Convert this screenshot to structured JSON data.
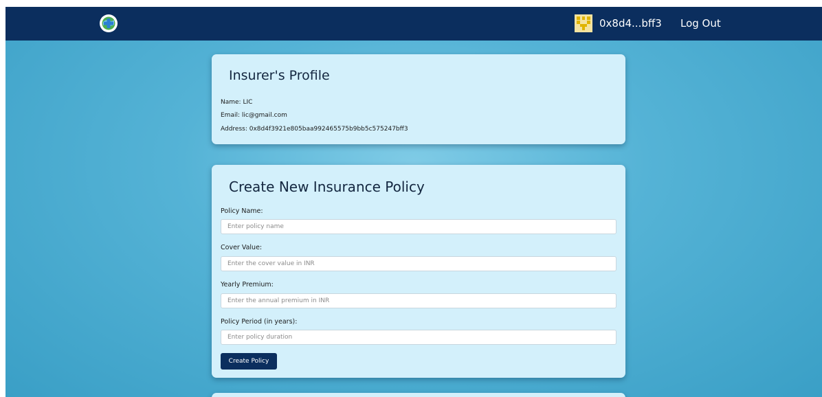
{
  "header": {
    "logo_icon": "medical-cross-globe-icon",
    "avatar_icon": "identicon-avatar",
    "wallet_address": "0x8d4...bff3",
    "logout_label": "Log Out"
  },
  "profile": {
    "title": "Insurer's Profile",
    "name_line": "Name: LIC",
    "email_line": "Email: lic@gmail.com",
    "address_line": "Address: 0x8d4f3921e805baa992465575b9bb5c575247bff3"
  },
  "policy_form": {
    "title": "Create New Insurance Policy",
    "fields": [
      {
        "label": "Policy Name:",
        "placeholder": "Enter policy name",
        "value": ""
      },
      {
        "label": "Cover Value:",
        "placeholder": "Enter the cover value in INR",
        "value": ""
      },
      {
        "label": "Yearly Premium:",
        "placeholder": "Enter the annual premium in INR",
        "value": ""
      },
      {
        "label": "Policy Period (in years):",
        "placeholder": "Enter policy duration",
        "value": ""
      }
    ],
    "submit_label": "Create Policy"
  },
  "colors": {
    "navbar": "#0b2e5e",
    "card_background": "#d3f0fb",
    "page_background": "#55b3d6",
    "button": "#0b2e5e"
  }
}
